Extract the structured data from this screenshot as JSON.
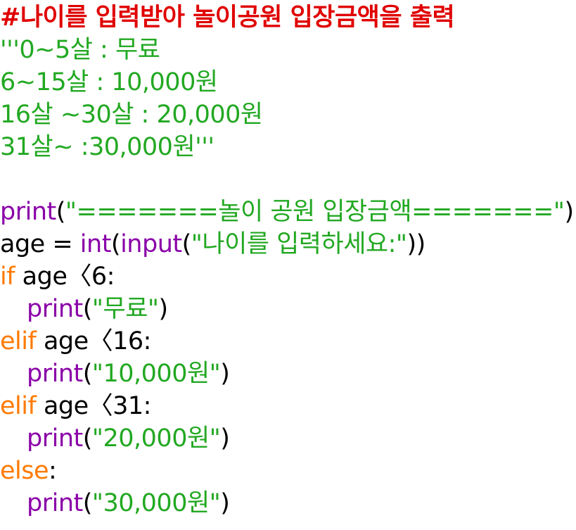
{
  "code_lines": [
    {
      "kind": "comment",
      "text": "#나이를 입력받아 놀이공원 입장금액을 출력"
    },
    {
      "kind": "docstring",
      "text": "'''0~5살 : 무료"
    },
    {
      "kind": "docstring",
      "text": "6~15살 : 10,000원"
    },
    {
      "kind": "docstring",
      "text": "16살 ~30살 : 20,000원"
    },
    {
      "kind": "docstring",
      "text": "31살~ :30,000원'''"
    },
    {
      "kind": "blank",
      "text": ""
    },
    {
      "kind": "code",
      "tokens": [
        {
          "type": "func",
          "text": "print"
        },
        {
          "type": "plain",
          "text": "("
        },
        {
          "type": "str",
          "text": "\"=======놀이 공원 입장금액=======\""
        },
        {
          "type": "plain",
          "text": ")"
        }
      ]
    },
    {
      "kind": "code",
      "tokens": [
        {
          "type": "plain",
          "text": "age = "
        },
        {
          "type": "func",
          "text": "int"
        },
        {
          "type": "plain",
          "text": "("
        },
        {
          "type": "func",
          "text": "input"
        },
        {
          "type": "plain",
          "text": "("
        },
        {
          "type": "str",
          "text": "\"나이를 입력하세요:\""
        },
        {
          "type": "plain",
          "text": "))"
        }
      ]
    },
    {
      "kind": "code",
      "tokens": [
        {
          "type": "kw",
          "text": "if"
        },
        {
          "type": "plain",
          "text": " age〈6:"
        }
      ]
    },
    {
      "kind": "code",
      "indent": true,
      "tokens": [
        {
          "type": "func",
          "text": "print"
        },
        {
          "type": "plain",
          "text": "("
        },
        {
          "type": "str",
          "text": "\"무료\""
        },
        {
          "type": "plain",
          "text": ")"
        }
      ]
    },
    {
      "kind": "code",
      "tokens": [
        {
          "type": "kw",
          "text": "elif"
        },
        {
          "type": "plain",
          "text": " age〈16:"
        }
      ]
    },
    {
      "kind": "code",
      "indent": true,
      "tokens": [
        {
          "type": "func",
          "text": "print"
        },
        {
          "type": "plain",
          "text": "("
        },
        {
          "type": "str",
          "text": "\"10,000원\""
        },
        {
          "type": "plain",
          "text": ")"
        }
      ]
    },
    {
      "kind": "code",
      "tokens": [
        {
          "type": "kw",
          "text": "elif"
        },
        {
          "type": "plain",
          "text": " age〈31:"
        }
      ]
    },
    {
      "kind": "code",
      "indent": true,
      "tokens": [
        {
          "type": "func",
          "text": "print"
        },
        {
          "type": "plain",
          "text": "("
        },
        {
          "type": "str",
          "text": "\"20,000원\""
        },
        {
          "type": "plain",
          "text": ")"
        }
      ]
    },
    {
      "kind": "code",
      "tokens": [
        {
          "type": "kw",
          "text": "else"
        },
        {
          "type": "plain",
          "text": ":"
        }
      ]
    },
    {
      "kind": "code",
      "indent": true,
      "tokens": [
        {
          "type": "func",
          "text": "print"
        },
        {
          "type": "plain",
          "text": "("
        },
        {
          "type": "str",
          "text": "\"30,000원\""
        },
        {
          "type": "plain",
          "text": ")"
        }
      ]
    }
  ],
  "colors": {
    "comment": "#e00000",
    "docstring": "#22a822",
    "func": "#8a00a8",
    "string": "#22a822",
    "keyword": "#ff7a00",
    "plain": "#000000"
  }
}
